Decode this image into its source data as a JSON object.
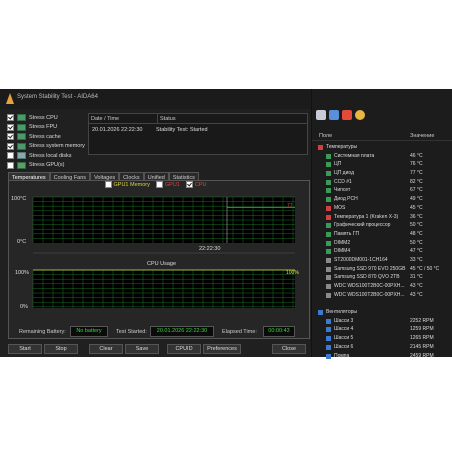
{
  "window": {
    "title": "System Stability Test - AIDA64"
  },
  "stress_options": [
    {
      "label": "Stress CPU",
      "checked": true
    },
    {
      "label": "Stress FPU",
      "checked": true
    },
    {
      "label": "Stress cache",
      "checked": true
    },
    {
      "label": "Stress system memory",
      "checked": true
    },
    {
      "label": "Stress local disks",
      "checked": false
    },
    {
      "label": "Stress GPU(s)",
      "checked": false
    }
  ],
  "log": {
    "col_datetime": "Date / Time",
    "col_status": "Status",
    "entry_datetime": "20.01.2026 22:22:30",
    "entry_status": "Stability Test: Started"
  },
  "tabs": [
    "Temperatures",
    "Cooling Fans",
    "Voltages",
    "Clocks",
    "Unified",
    "Statistics"
  ],
  "temp_chart": {
    "legend": [
      "GPU1 Memory",
      "GPU1",
      "CPU"
    ],
    "y_top": "100°C",
    "y_bottom": "0°C",
    "x_label": "22:22:30",
    "value_label": "77"
  },
  "cpu_chart": {
    "title": "CPU Usage",
    "y_top": "100%",
    "y_bottom": "0%",
    "value_label": "100%"
  },
  "chart_data": [
    {
      "type": "line",
      "title": "",
      "series": [
        {
          "name": "CPU",
          "values": [
            77,
            77,
            77,
            77
          ]
        }
      ],
      "ylim": [
        0,
        100
      ],
      "ylabel": "",
      "xlabel": "22:22:30"
    },
    {
      "type": "line",
      "title": "CPU Usage",
      "series": [
        {
          "name": "CPU Usage",
          "values": [
            100,
            100,
            100,
            100
          ]
        }
      ],
      "ylim": [
        0,
        100
      ]
    }
  ],
  "status": {
    "battery_label": "Remaining Battery:",
    "battery_value": "No battery",
    "started_label": "Test Started:",
    "started_value": "20.01.2026 22:22:30",
    "elapsed_label": "Elapsed Time:",
    "elapsed_value": "00:00:43"
  },
  "buttons": {
    "start": "Start",
    "stop": "Stop",
    "clear": "Clear",
    "save": "Save",
    "cpuid": "CPUID",
    "preferences": "Preferences",
    "close": "Close"
  },
  "sensors": {
    "col_field": "Поле",
    "col_value": "Значение",
    "rows": [
      {
        "name": "Температуры",
        "value": "",
        "indent": 0,
        "icon": "thermometer-icon",
        "color": "#d04040"
      },
      {
        "name": "Системная плата",
        "value": "46 °C",
        "indent": 1,
        "icon": "motherboard-icon",
        "color": "#3a9a5a"
      },
      {
        "name": "ЦП",
        "value": "76 °C",
        "indent": 1,
        "icon": "cpu-icon",
        "color": "#3a9a5a"
      },
      {
        "name": "ЦП диод",
        "value": "77 °C",
        "indent": 1,
        "icon": "cpu-icon",
        "color": "#3a9a5a"
      },
      {
        "name": "CCD #1",
        "value": "82 °C",
        "indent": 1,
        "icon": "cpu-icon",
        "color": "#3a9a5a"
      },
      {
        "name": "Чипсет",
        "value": "67 °C",
        "indent": 1,
        "icon": "chip-icon",
        "color": "#3a9a5a"
      },
      {
        "name": "Диод PCH",
        "value": "49 °C",
        "indent": 1,
        "icon": "chip-icon",
        "color": "#3a9a5a"
      },
      {
        "name": "MOS",
        "value": "45 °C",
        "indent": 1,
        "icon": "thermometer-icon",
        "color": "#d04040"
      },
      {
        "name": "Температура 1 (Kraken X-3)",
        "value": "36 °C",
        "indent": 1,
        "icon": "thermometer-icon",
        "color": "#d04040"
      },
      {
        "name": "Графический процессор",
        "value": "50 °C",
        "indent": 1,
        "icon": "gpu-icon",
        "color": "#3a9a5a"
      },
      {
        "name": "Память ГП",
        "value": "48 °C",
        "indent": 1,
        "icon": "memory-icon",
        "color": "#3a9a5a"
      },
      {
        "name": "DIMM2",
        "value": "50 °C",
        "indent": 1,
        "icon": "memory-icon",
        "color": "#3a9a5a"
      },
      {
        "name": "DIMM4",
        "value": "47 °C",
        "indent": 1,
        "icon": "memory-icon",
        "color": "#3a9a5a"
      },
      {
        "name": "ST2000DM001-1CH164",
        "value": "33 °C",
        "indent": 1,
        "icon": "disk-icon",
        "color": "#8a8a8a"
      },
      {
        "name": "Samsung SSD 970 EVO 250GB",
        "value": "45 °C / 50 °C",
        "indent": 1,
        "icon": "disk-icon",
        "color": "#8a8a8a"
      },
      {
        "name": "Samsung SSD 870 QVO 2TB",
        "value": "31 °C",
        "indent": 1,
        "icon": "disk-icon",
        "color": "#8a8a8a"
      },
      {
        "name": "WDC WDS100T2B0C-00PXH...",
        "value": "43 °C",
        "indent": 1,
        "icon": "disk-icon",
        "color": "#8a8a8a"
      },
      {
        "name": "WDC WDS100T2B0C-00PXH...",
        "value": "43 °C",
        "indent": 1,
        "icon": "disk-icon",
        "color": "#8a8a8a"
      },
      {
        "name": "",
        "value": "",
        "indent": 0,
        "icon": "",
        "color": ""
      },
      {
        "name": "Вентиляторы",
        "value": "",
        "indent": 0,
        "icon": "fan-icon",
        "color": "#3a7ad0"
      },
      {
        "name": "Шасси 3",
        "value": "2252 RPM",
        "indent": 1,
        "icon": "fan-icon",
        "color": "#3a7ad0"
      },
      {
        "name": "Шасси 4",
        "value": "1259 RPM",
        "indent": 1,
        "icon": "fan-icon",
        "color": "#3a7ad0"
      },
      {
        "name": "Шасси 5",
        "value": "1265 RPM",
        "indent": 1,
        "icon": "fan-icon",
        "color": "#3a7ad0"
      },
      {
        "name": "Шасси 6",
        "value": "2145 RPM",
        "indent": 1,
        "icon": "fan-icon",
        "color": "#3a7ad0"
      },
      {
        "name": "Помпа",
        "value": "2459 RPM",
        "indent": 1,
        "icon": "pump-icon",
        "color": "#3a7ad0"
      }
    ]
  },
  "colors": {
    "grid": "#1f8a2a",
    "cpu_line": "#e04040",
    "usage_line": "#e0e040",
    "accent": "#3ad63a"
  }
}
